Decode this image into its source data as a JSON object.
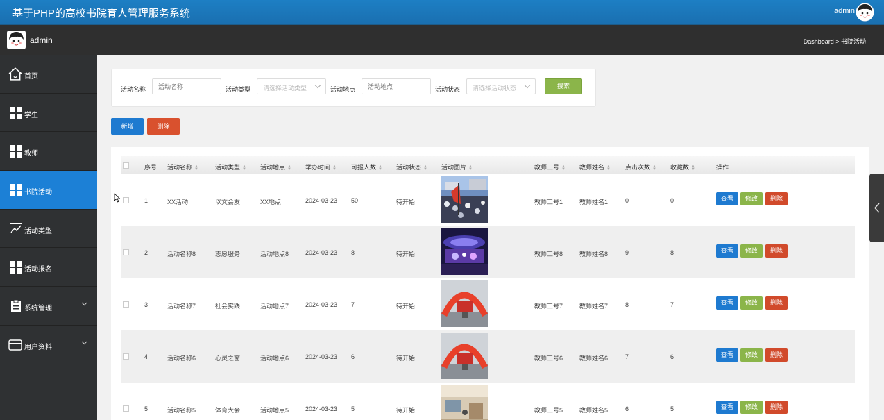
{
  "app": {
    "title": "基于PHP的高校书院育人管理服务系统",
    "user": "admin"
  },
  "subbar": {
    "name": "admin",
    "breadcrumb": "Dashboard > 书院活动"
  },
  "sidebar": {
    "items": [
      {
        "label": "首页",
        "icon": "home-icon"
      },
      {
        "label": "学生",
        "icon": "grid-icon"
      },
      {
        "label": "教师",
        "icon": "grid-icon"
      },
      {
        "label": "书院活动",
        "icon": "grid-icon",
        "active": true
      },
      {
        "label": "活动类型",
        "icon": "chart-line-icon"
      },
      {
        "label": "活动报名",
        "icon": "grid-icon"
      },
      {
        "label": "系统管理",
        "icon": "clipboard-icon"
      },
      {
        "label": "用户资料",
        "icon": "card-icon"
      }
    ]
  },
  "search": {
    "name_label": "活动名称",
    "name_placeholder": "活动名称",
    "type_label": "活动类型",
    "type_placeholder": "请选择活动类型",
    "place_label": "活动地点",
    "place_placeholder": "活动地点",
    "status_label": "活动状态",
    "status_placeholder": "请选择活动状态",
    "search_button": "搜索"
  },
  "toolbar": {
    "add_label": "新增",
    "delete_label": "删除"
  },
  "table": {
    "headers": [
      "序号",
      "活动名称",
      "活动类型",
      "活动地点",
      "举办时间",
      "可报人数",
      "活动状态",
      "活动图片",
      "教师工号",
      "教师姓名",
      "点击次数",
      "收藏数",
      "操作"
    ],
    "rows": [
      {
        "no": "1",
        "name": "XX活动",
        "type": "以文会友",
        "place": "XX地点",
        "date": "2024-03-23",
        "capacity": "50",
        "status": "待开始",
        "teacher_id": "教师工号1",
        "teacher_name": "教师姓名1",
        "clicks": "0",
        "favorites": "0"
      },
      {
        "no": "2",
        "name": "活动名称8",
        "type": "志愿服务",
        "place": "活动地点8",
        "date": "2024-03-23",
        "capacity": "8",
        "status": "待开始",
        "teacher_id": "教师工号8",
        "teacher_name": "教师姓名8",
        "clicks": "9",
        "favorites": "8"
      },
      {
        "no": "3",
        "name": "活动名称7",
        "type": "社会实践",
        "place": "活动地点7",
        "date": "2024-03-23",
        "capacity": "7",
        "status": "待开始",
        "teacher_id": "教师工号7",
        "teacher_name": "教师姓名7",
        "clicks": "8",
        "favorites": "7"
      },
      {
        "no": "4",
        "name": "活动名称6",
        "type": "心灵之窗",
        "place": "活动地点6",
        "date": "2024-03-23",
        "capacity": "6",
        "status": "待开始",
        "teacher_id": "教师工号6",
        "teacher_name": "教师姓名6",
        "clicks": "7",
        "favorites": "6"
      },
      {
        "no": "5",
        "name": "活动名称5",
        "type": "体育大会",
        "place": "活动地点5",
        "date": "2024-03-23",
        "capacity": "5",
        "status": "待开始",
        "teacher_id": "教师工号5",
        "teacher_name": "教师姓名5",
        "clicks": "6",
        "favorites": "5"
      }
    ],
    "actions": {
      "view": "查看",
      "edit": "修改",
      "remove": "删除"
    }
  },
  "colors": {
    "primary": "#1e7ad0",
    "success": "#8bb54a",
    "danger": "#d14a2b",
    "sidebar": "#2f3133",
    "topbar": "#1d7fc4"
  }
}
